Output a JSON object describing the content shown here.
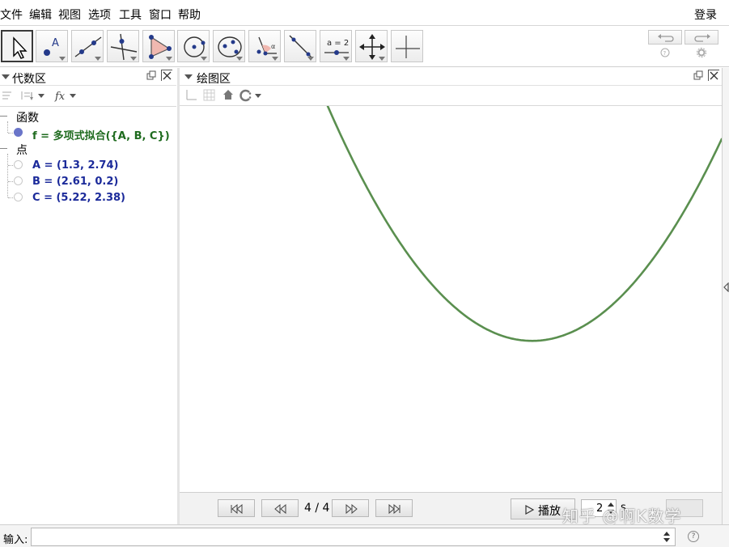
{
  "menu": {
    "items": [
      "文件",
      "编辑",
      "视图",
      "选项",
      "工具",
      "窗口",
      "帮助"
    ],
    "login": "登录"
  },
  "toolbar": {
    "tools": [
      "move-tool",
      "point-tool",
      "line-tool",
      "perpendicular-tool",
      "polygon-tool",
      "circle-tool",
      "conic-tool",
      "angle-tool",
      "reflect-tool",
      "slider-tool",
      "move-view-tool",
      "axes-tool"
    ],
    "slider_label": "a = 2"
  },
  "algebra": {
    "title": "代数区",
    "categories": [
      {
        "name": "函数",
        "items": [
          {
            "text": "f = 多项式拟合({A, B, C})",
            "type": "func",
            "shown": true
          }
        ]
      },
      {
        "name": "点",
        "items": [
          {
            "text": "A = (1.3, 2.74)",
            "type": "pt",
            "shown": false
          },
          {
            "text": "B = (2.61, 0.2)",
            "type": "pt",
            "shown": false
          },
          {
            "text": "C = (5.22, 2.38)",
            "type": "pt",
            "shown": false
          }
        ]
      }
    ]
  },
  "graphics": {
    "title": "绘图区",
    "curve_color": "#5a8f4f",
    "curve": {
      "vertex_x": 3.0,
      "vertex_y": -0.1
    }
  },
  "animation": {
    "step": "4 / 4",
    "play_label": "播放",
    "spinner_value": "2",
    "spinner_suffix": "s"
  },
  "input": {
    "label": "输入:",
    "value": ""
  },
  "watermark": "知乎 @啊K数学"
}
